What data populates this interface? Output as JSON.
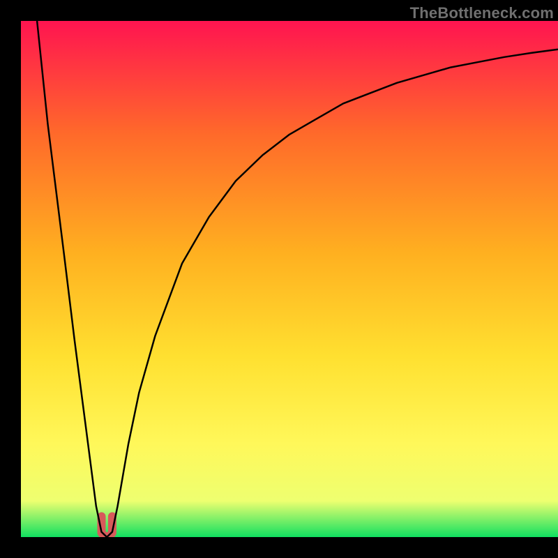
{
  "watermark": "TheBottleneck.com",
  "colors": {
    "black": "#000000",
    "watermark": "#707070",
    "curve": "#000000",
    "marker": "#d75a5a",
    "grad_top": "#ff1450",
    "grad_mid1": "#ff6a2a",
    "grad_mid2": "#ffb020",
    "grad_mid3": "#ffe030",
    "grad_mid4": "#fff85a",
    "grad_mid5": "#eeff70",
    "grad_bot": "#10e060"
  },
  "chart_data": {
    "type": "line",
    "title": "",
    "xlabel": "",
    "ylabel": "",
    "xlim": [
      0,
      100
    ],
    "ylim": [
      0,
      100
    ],
    "x": [
      3,
      5,
      8,
      10,
      12,
      13,
      14,
      15,
      16,
      17,
      18,
      19,
      20,
      22,
      25,
      30,
      35,
      40,
      45,
      50,
      55,
      60,
      65,
      70,
      75,
      80,
      85,
      90,
      95,
      100
    ],
    "values": [
      100,
      80,
      55,
      38,
      22,
      14,
      6,
      1,
      0,
      1,
      6,
      12,
      18,
      28,
      39,
      53,
      62,
      69,
      74,
      78,
      81,
      84,
      86,
      88,
      89.5,
      91,
      92,
      93,
      93.8,
      94.5
    ],
    "minimum_x": 16,
    "minimum_y": 0,
    "marker_band": {
      "x0": 15,
      "x1": 17,
      "y0": 0,
      "y1": 4
    }
  }
}
